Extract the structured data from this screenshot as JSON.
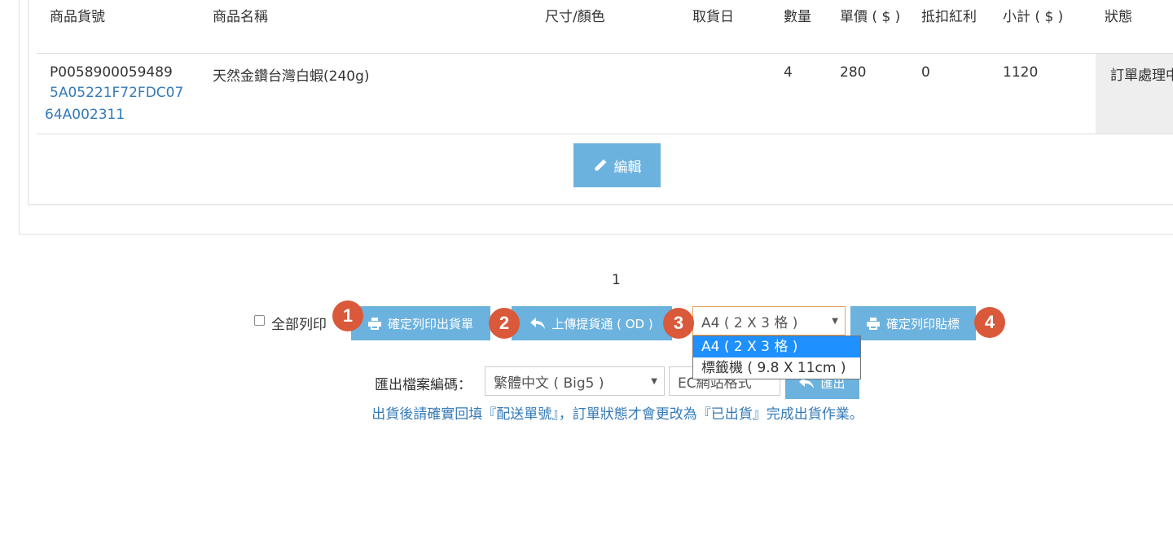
{
  "table": {
    "headers": [
      "商品貨號",
      "商品名稱",
      "尺寸/顏色",
      "取貨日",
      "數量",
      "單價 ( $ )",
      "抵扣紅利",
      "小計 ( $ )",
      "狀態"
    ],
    "row": {
      "product_no": "P0058900059489",
      "product_code_line1": "5A05221F72FDC07",
      "product_code_line2": "64A002311",
      "product_name": "天然金鑽台灣白蝦(240g)",
      "size_color": "",
      "pickup_date": "",
      "quantity": "4",
      "unit_price": "280",
      "bonus_deduct": "0",
      "subtotal": "1120",
      "status": "訂單處理中"
    },
    "edit_button": "編輯"
  },
  "pagination": {
    "current_page": "1"
  },
  "actions": {
    "print_all_label": "全部列印",
    "print_all_checked": false,
    "confirm_print_shipping": "確定列印出貨單",
    "upload_tracking": "上傳提貨通 ( OD )",
    "label_format_selected": "A4 ( 2 X 3 格 )",
    "label_format_options": [
      "A4 ( 2 X 3 格 )",
      "標籤機 ( 9.8 X 11cm )"
    ],
    "confirm_print_labels": "確定列印貼標",
    "badges": [
      "1",
      "2",
      "3",
      "4"
    ]
  },
  "export": {
    "encoding_label": "匯出檔案編碼：",
    "encoding_selected": "繁體中文 ( Big5 )",
    "format_selected": "EC網站格式",
    "export_button": "匯出"
  },
  "notice": "出貨後請確實回填『配送單號』，訂單狀態才會更改為『已出貨』完成出貨作業。",
  "colors": {
    "button": "#6cb2de",
    "badge": "#d9593a",
    "link": "#337ab7",
    "selected_option": "#1e90ff"
  }
}
